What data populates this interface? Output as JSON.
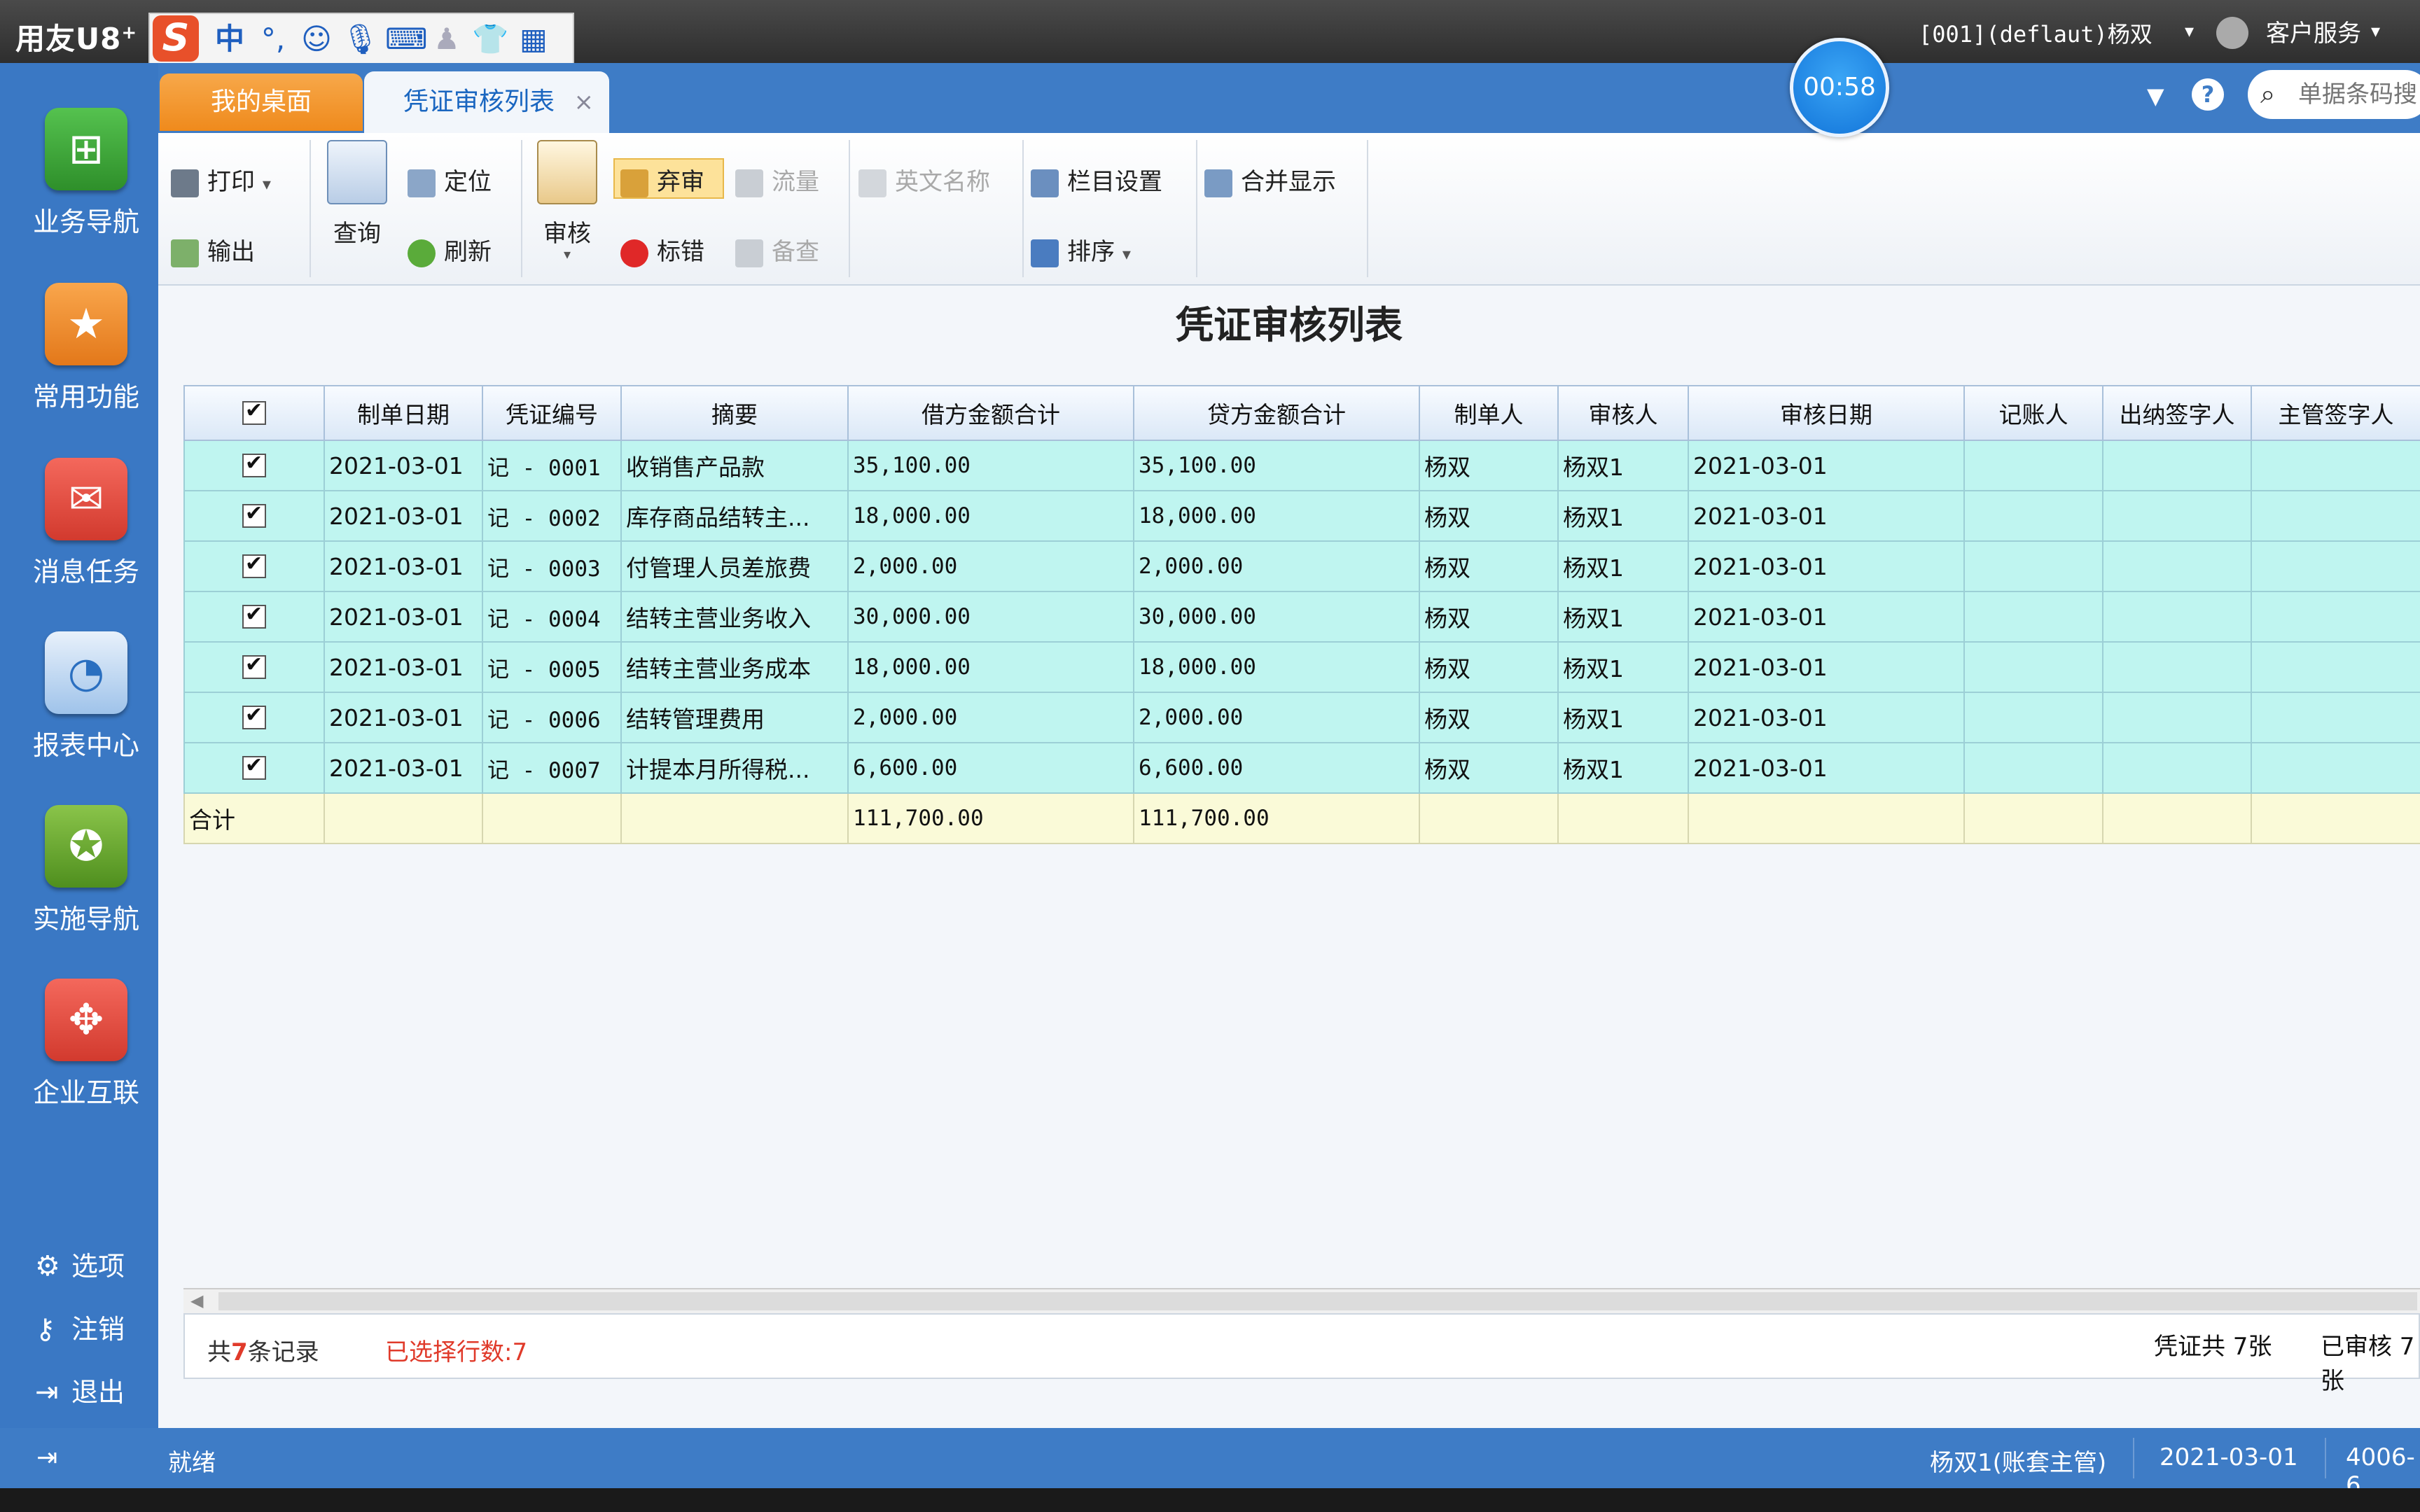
{
  "app": {
    "logo": "用友U8",
    "logo_sup": "+",
    "user": "[001](deflaut)杨双",
    "service": "客户服务",
    "timer": "00:58"
  },
  "ime": {
    "icons": [
      "ime-s-icon",
      "chinese-mode-icon",
      "punctuation-icon",
      "emoji-icon",
      "microphone-icon",
      "keyboard-icon",
      "user-icon",
      "skin-icon",
      "grid-icon"
    ],
    "label": "中"
  },
  "sidebar": {
    "items": [
      {
        "label": "业务导航",
        "icon": "business-nav-icon",
        "color": "#3aa83a"
      },
      {
        "label": "常用功能",
        "icon": "favorites-icon",
        "color": "#f08a1c"
      },
      {
        "label": "消息任务",
        "icon": "message-icon",
        "color": "#e0483c"
      },
      {
        "label": "报表中心",
        "icon": "report-icon",
        "color": "#4a8fd8"
      },
      {
        "label": "实施导航",
        "icon": "compass-icon",
        "color": "#6aa82a"
      },
      {
        "label": "企业互联",
        "icon": "enterprise-icon",
        "color": "#e04a3c"
      }
    ],
    "bottom": [
      {
        "label": "选项",
        "icon": "gear-icon"
      },
      {
        "label": "注销",
        "icon": "key-icon"
      },
      {
        "label": "退出",
        "icon": "exit-icon"
      }
    ]
  },
  "tabs": {
    "desktop": "我的桌面",
    "active": "凭证审核列表",
    "close": "×"
  },
  "search": {
    "placeholder": "单据条码搜"
  },
  "toolbar": {
    "print": "打印",
    "export": "输出",
    "query": "查询",
    "locate": "定位",
    "refresh": "刷新",
    "audit": "审核",
    "abandon": "弃审",
    "mark_error": "标错",
    "flow": "流量",
    "backup": "备查",
    "english_name": "英文名称",
    "column_settings": "栏目设置",
    "sort": "排序",
    "merge_display": "合并显示"
  },
  "page": {
    "title": "凭证审核列表"
  },
  "table": {
    "headers": [
      "制单日期",
      "凭证编号",
      "摘要",
      "借方金额合计",
      "贷方金额合计",
      "制单人",
      "审核人",
      "审核日期",
      "记账人",
      "出纳签字人",
      "主管签字人"
    ],
    "rows": [
      {
        "date": "2021-03-01",
        "no": "记 - 0001",
        "summary": "收销售产品款",
        "debit": "35,100.00",
        "credit": "35,100.00",
        "maker": "杨双",
        "auditor": "杨双1",
        "audit_date": "2021-03-01"
      },
      {
        "date": "2021-03-01",
        "no": "记 - 0002",
        "summary": "库存商品结转主...",
        "debit": "18,000.00",
        "credit": "18,000.00",
        "maker": "杨双",
        "auditor": "杨双1",
        "audit_date": "2021-03-01"
      },
      {
        "date": "2021-03-01",
        "no": "记 - 0003",
        "summary": "付管理人员差旅费",
        "debit": "2,000.00",
        "credit": "2,000.00",
        "maker": "杨双",
        "auditor": "杨双1",
        "audit_date": "2021-03-01"
      },
      {
        "date": "2021-03-01",
        "no": "记 - 0004",
        "summary": "结转主营业务收入",
        "debit": "30,000.00",
        "credit": "30,000.00",
        "maker": "杨双",
        "auditor": "杨双1",
        "audit_date": "2021-03-01"
      },
      {
        "date": "2021-03-01",
        "no": "记 - 0005",
        "summary": "结转主营业务成本",
        "debit": "18,000.00",
        "credit": "18,000.00",
        "maker": "杨双",
        "auditor": "杨双1",
        "audit_date": "2021-03-01"
      },
      {
        "date": "2021-03-01",
        "no": "记 - 0006",
        "summary": "结转管理费用",
        "debit": "2,000.00",
        "credit": "2,000.00",
        "maker": "杨双",
        "auditor": "杨双1",
        "audit_date": "2021-03-01"
      },
      {
        "date": "2021-03-01",
        "no": "记 - 0007",
        "summary": "计提本月所得税...",
        "debit": "6,600.00",
        "credit": "6,600.00",
        "maker": "杨双",
        "auditor": "杨双1",
        "audit_date": "2021-03-01"
      }
    ],
    "total": {
      "label": "合计",
      "debit": "111,700.00",
      "credit": "111,700.00"
    }
  },
  "footer": {
    "records_pre": "共",
    "records_count": "7",
    "records_post": "条记录",
    "selected": "已选择行数:7",
    "vouchers_total": "凭证共 7张",
    "audited": "已审核 7 张"
  },
  "status": {
    "ready": "就绪",
    "user": "杨双1(账套主管)",
    "date": "2021-03-01",
    "phone": "4006-6"
  }
}
